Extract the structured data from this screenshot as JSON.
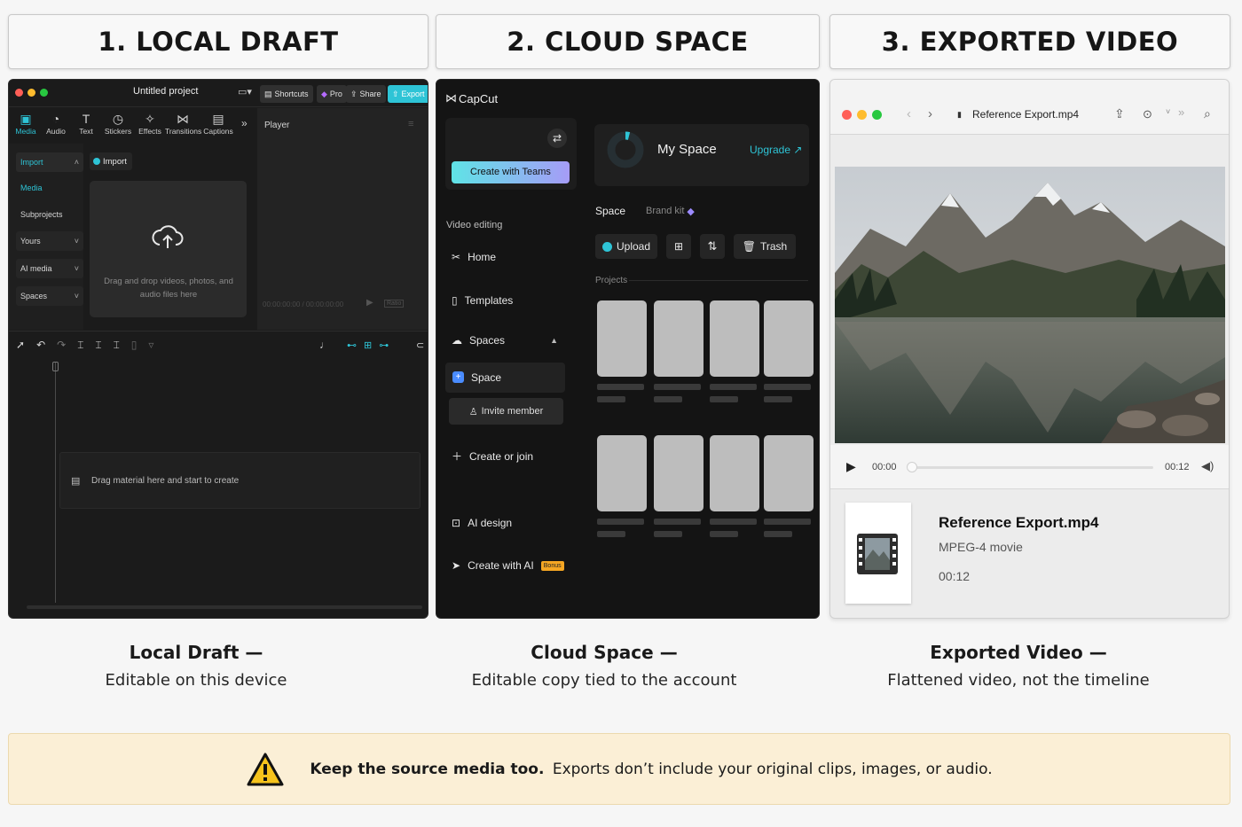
{
  "headers": [
    "1. LOCAL DRAFT",
    "2. CLOUD SPACE",
    "3. EXPORTED VIDEO"
  ],
  "local": {
    "title": "Untitled project",
    "shortcuts": "Shortcuts",
    "pro": "Pro",
    "share": "Share",
    "export": "Export",
    "tools": [
      "Media",
      "Audio",
      "Text",
      "Stickers",
      "Effects",
      "Transitions",
      "Captions"
    ],
    "sidebar": [
      "Import",
      "Media",
      "Subprojects",
      "Yours",
      "AI media",
      "Spaces"
    ],
    "import_btn": "Import",
    "drop_text": "Drag and drop videos, photos, and audio files here",
    "player": "Player",
    "timecode": "00:00:00:00 / 00:00:00:00",
    "ratio": "Ratio",
    "timeline_hint": "Drag material here and start to create"
  },
  "cloud": {
    "brand": "CapCut",
    "create_teams": "Create with Teams",
    "section": "Video editing",
    "nav": [
      "Home",
      "Templates",
      "Spaces",
      "Space",
      "Invite member",
      "Create or join",
      "AI design",
      "Create with AI"
    ],
    "bonus": "Bonus",
    "my_space": "My Space",
    "upgrade": "Upgrade ↗",
    "tab_space": "Space",
    "tab_brand": "Brand kit",
    "upload": "Upload",
    "trash": "Trash",
    "projects": "Projects"
  },
  "exported": {
    "filename": "Reference Export.mp4",
    "time_start": "00:00",
    "time_end": "00:12",
    "kind": "MPEG-4 movie",
    "duration": "00:12"
  },
  "captions": [
    {
      "title": "Local Draft —",
      "sub": "Editable on this device"
    },
    {
      "title": "Cloud Space —",
      "sub": "Editable copy tied to the account"
    },
    {
      "title": "Exported Video —",
      "sub": "Flattened video, not the timeline"
    }
  ],
  "banner": {
    "bold": "Keep the source media too.",
    "text": "Exports don’t include your original clips, images, or audio."
  },
  "colors": {
    "accent_teal": "#2ec4d6",
    "teams_purple": "#7e86f3",
    "bonus_orange": "#f5a623",
    "banner_bg": "#fbefd6"
  }
}
